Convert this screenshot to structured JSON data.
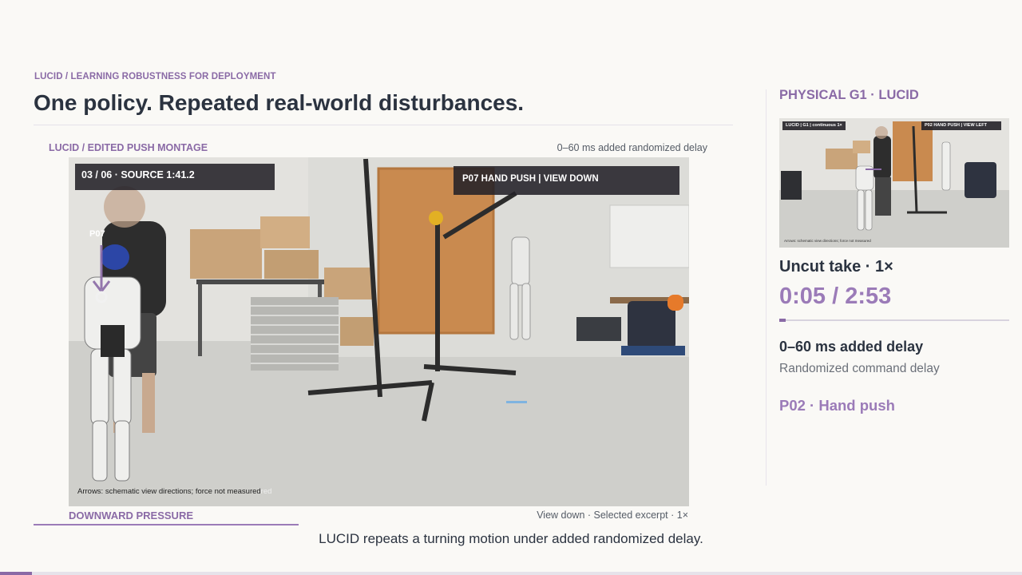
{
  "header": {
    "kicker": "LUCID / LEARNING ROBUSTNESS FOR DEPLOYMENT",
    "title": "One policy. Repeated real-world disturbances."
  },
  "montage": {
    "label": "LUCID / EDITED PUSH MONTAGE",
    "delay_note": "0–60 ms added randomized delay",
    "counter": "03 / 06 · SOURCE 1:41.2",
    "push_tag": "P07  HAND PUSH  |  VIEW DOWN",
    "marker": "P07",
    "arrows_note": "Arrows: schematic view directions; force not measured",
    "arrows_note_suffix": "red",
    "pressure_label": "DOWNWARD PRESSURE",
    "view_meta": "View down · Selected excerpt · 1×",
    "caption": "LUCID repeats a turning motion under added randomized delay."
  },
  "sidebar": {
    "heading": "PHYSICAL G1 · LUCID",
    "thumb_tag_left": "LUCID | G1 | continuous 1×",
    "thumb_tag_right": "P02 HAND PUSH | VIEW LEFT",
    "thumb_note": "Arrows: schematic view directions; force not measured",
    "uncut_label": "Uncut take · 1×",
    "timecode": "0:05 / 2:53",
    "progress_fraction": 0.029,
    "delay_strong": "0–60 ms added delay",
    "delay_sub": "Randomized command delay",
    "push_label": "P02 · Hand push"
  },
  "bottom_progress_fraction": 0.031,
  "colors": {
    "accent": "#8a6aa6",
    "accent_light": "#9b7bb8",
    "text": "#2b3340",
    "background": "#faf9f6"
  }
}
